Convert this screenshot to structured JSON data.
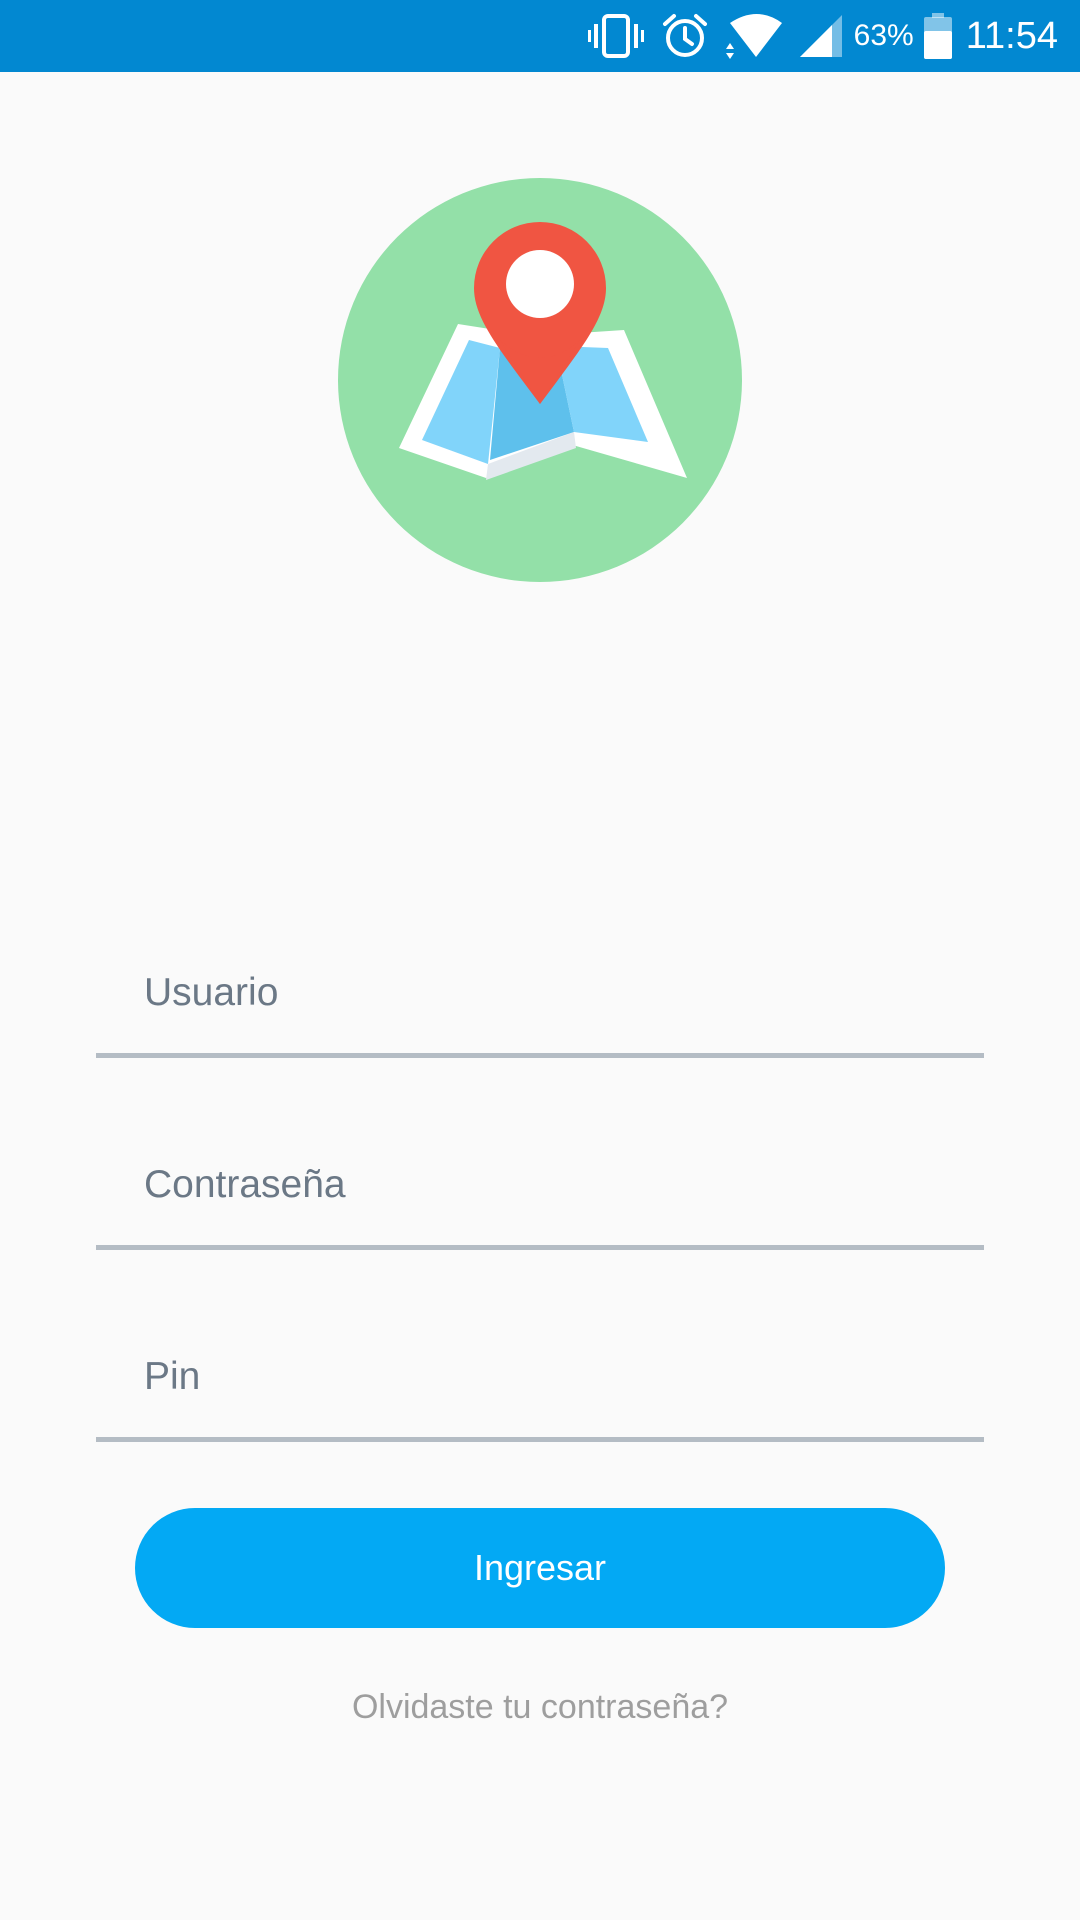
{
  "status_bar": {
    "battery_percent": "63%",
    "time": "11:54",
    "icons": [
      "vibrate-icon",
      "alarm-icon",
      "wifi-icon",
      "cellular-signal-icon",
      "battery-icon"
    ],
    "background_color": "#0288d1"
  },
  "logo": {
    "icon": "map-location-pin-icon",
    "circle_color": "#93e0a8",
    "pin_color": "#f05542",
    "map_color": "#81d4fa"
  },
  "form": {
    "username_placeholder": "Usuario",
    "username_value": "",
    "password_placeholder": "Contraseña",
    "password_value": "",
    "pin_placeholder": "Pin",
    "pin_value": "",
    "submit_label": "Ingresar",
    "submit_color": "#03a9f4",
    "forgot_label": "Olvidaste tu contraseña?"
  }
}
